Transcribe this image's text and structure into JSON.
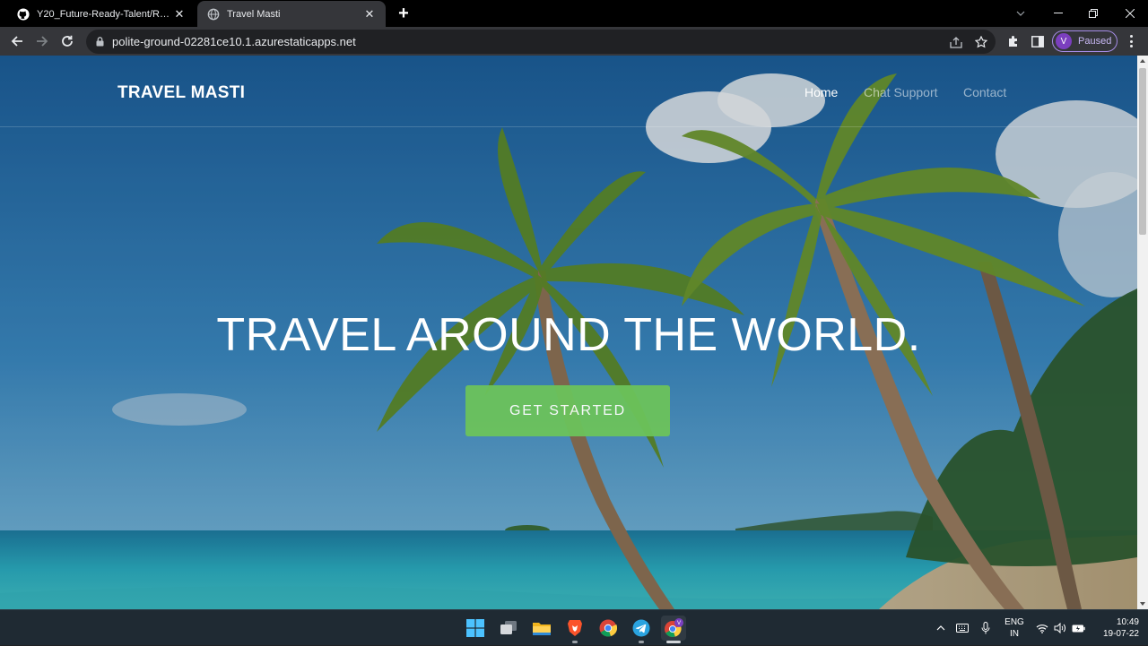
{
  "browser": {
    "tabs": [
      {
        "title": "Y20_Future-Ready-Talent/README.md",
        "favicon": "github-icon"
      },
      {
        "title": "Travel Masti",
        "favicon": "globe-icon"
      }
    ],
    "url": "polite-ground-02281ce10.1.azurestaticapps.net",
    "profile": {
      "initial": "V",
      "status": "Paused",
      "color": "#7b3fbf"
    }
  },
  "site": {
    "brand": "TRAVEL MASTI",
    "nav": {
      "home": "Home",
      "chat": "Chat Support",
      "contact": "Contact"
    },
    "headline": "TRAVEL AROUND THE WORLD.",
    "cta": "GET STARTED",
    "accent_color": "#6cc35b"
  },
  "taskbar": {
    "apps": [
      "windows-start-icon",
      "task-view-icon",
      "file-explorer-icon",
      "brave-icon",
      "chrome-icon",
      "telegram-icon",
      "chrome-profile-icon"
    ],
    "lang_line1": "ENG",
    "lang_line2": "IN",
    "time": "10:49",
    "date": "19-07-22"
  }
}
